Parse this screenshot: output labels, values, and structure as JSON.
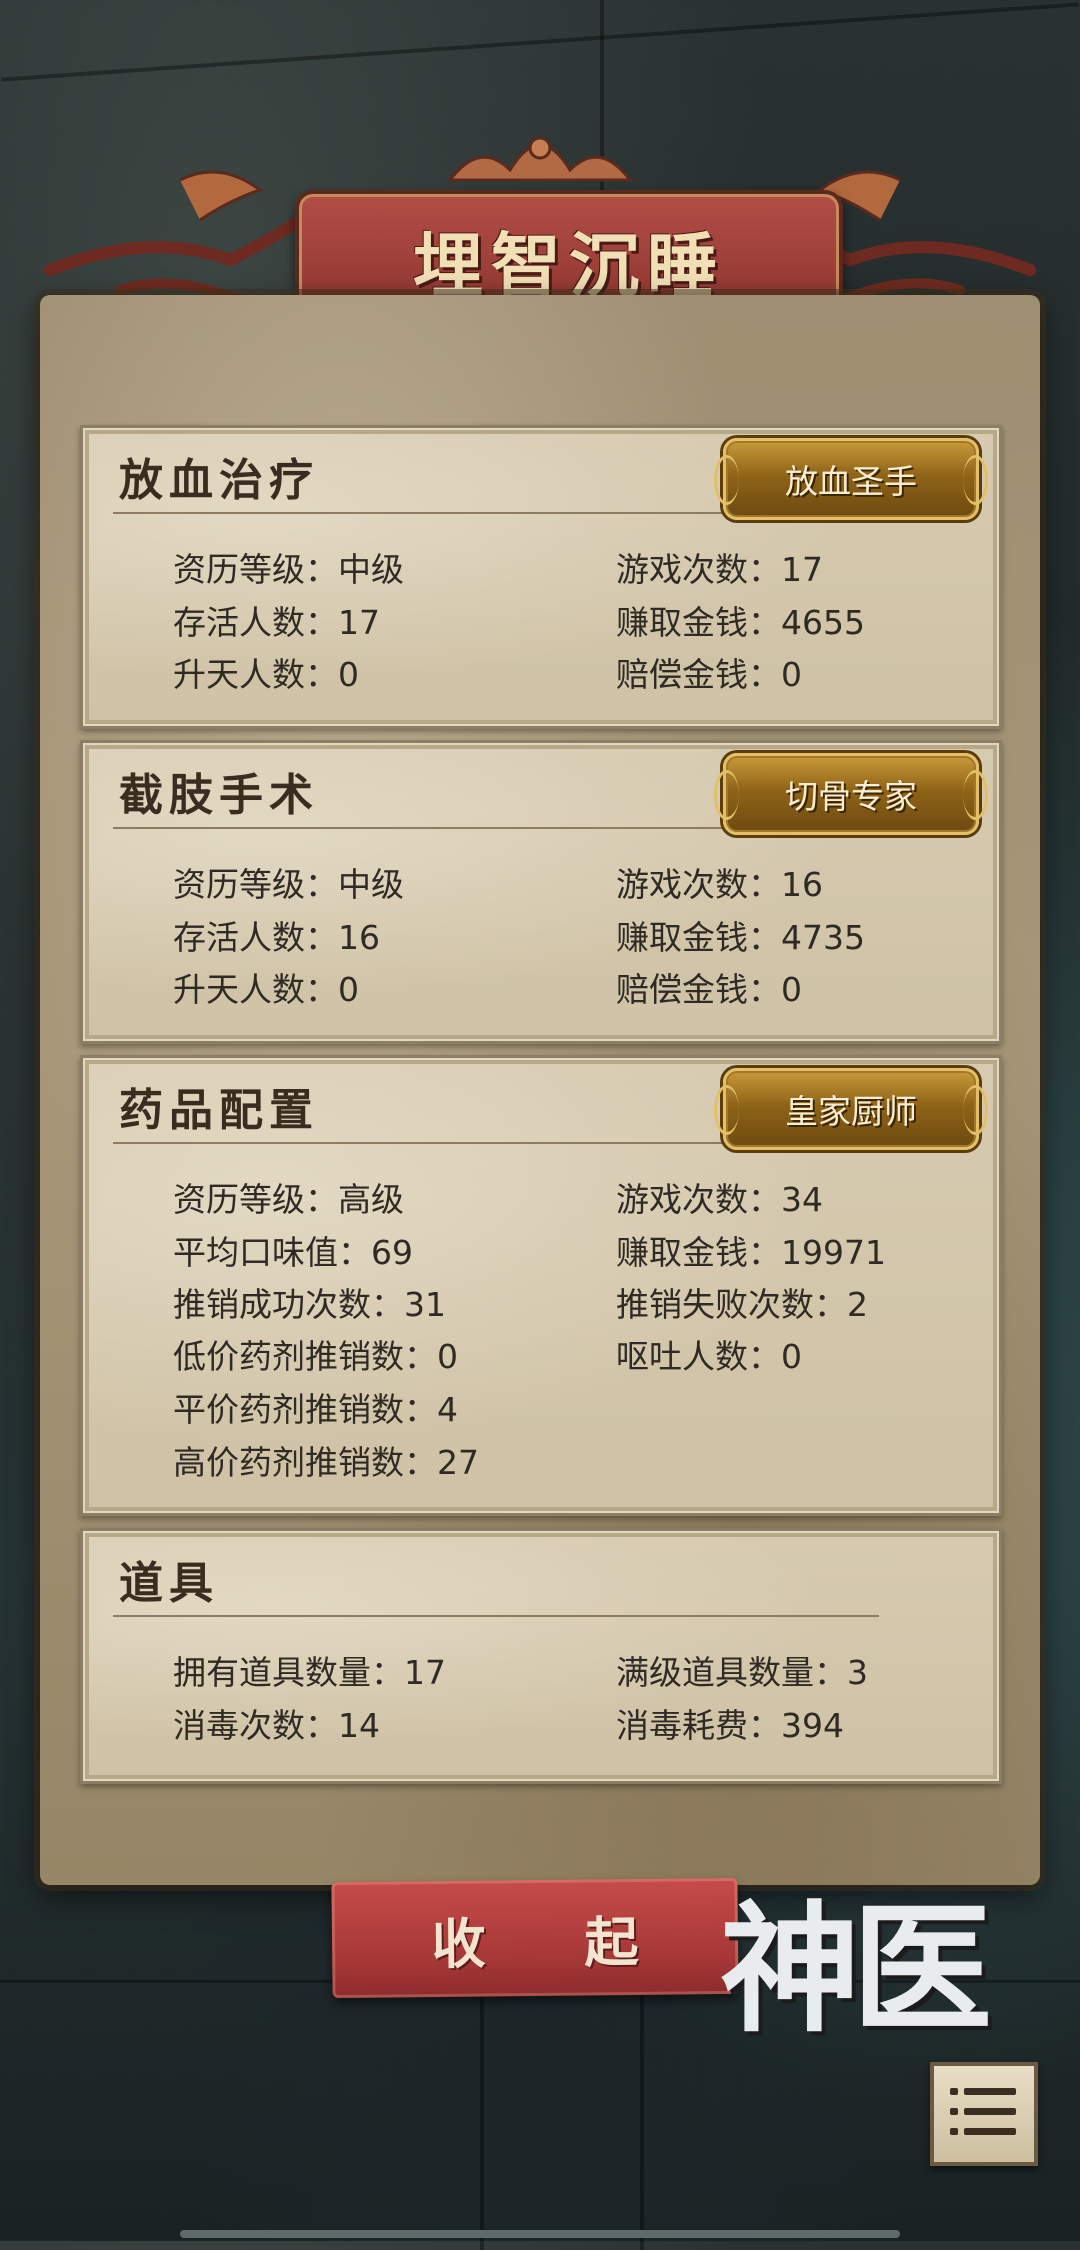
{
  "title": "埋智沉睡",
  "sections": [
    {
      "title": "放血治疗",
      "badge": "放血圣手",
      "stats": [
        {
          "label": "资历等级：中级"
        },
        {
          "label": "游戏次数：17"
        },
        {
          "label": "存活人数：17"
        },
        {
          "label": "赚取金钱：4655"
        },
        {
          "label": "升天人数：0"
        },
        {
          "label": "赔偿金钱：0"
        }
      ]
    },
    {
      "title": "截肢手术",
      "badge": "切骨专家",
      "stats": [
        {
          "label": "资历等级：中级"
        },
        {
          "label": "游戏次数：16"
        },
        {
          "label": "存活人数：16"
        },
        {
          "label": "赚取金钱：4735"
        },
        {
          "label": "升天人数：0"
        },
        {
          "label": "赔偿金钱：0"
        }
      ]
    },
    {
      "title": "药品配置",
      "badge": "皇家厨师",
      "stats": [
        {
          "label": "资历等级：高级"
        },
        {
          "label": "游戏次数：34"
        },
        {
          "label": "平均口味值：69"
        },
        {
          "label": "赚取金钱：19971"
        },
        {
          "label": "推销成功次数：31"
        },
        {
          "label": "推销失败次数：2"
        },
        {
          "label": "低价药剂推销数：0"
        },
        {
          "label": "呕吐人数：0"
        },
        {
          "label": "平价药剂推销数：4"
        },
        {
          "label": "高价药剂推销数：27"
        }
      ]
    },
    {
      "title": "道具",
      "stats": [
        {
          "label": "拥有道具数量：17"
        },
        {
          "label": "满级道具数量：3"
        },
        {
          "label": "消毒次数：14"
        },
        {
          "label": "消毒耗费：394"
        }
      ]
    }
  ],
  "collapse_button": "收 起",
  "logo": "神医",
  "icons": {
    "menu": "menu-icon",
    "ornament": "ornament-icon"
  },
  "colors": {
    "banner_red": "#9a3d37",
    "badge_gold": "#c89a3a",
    "button_red": "#b03e3d",
    "parchment": "#cfc2a6"
  }
}
